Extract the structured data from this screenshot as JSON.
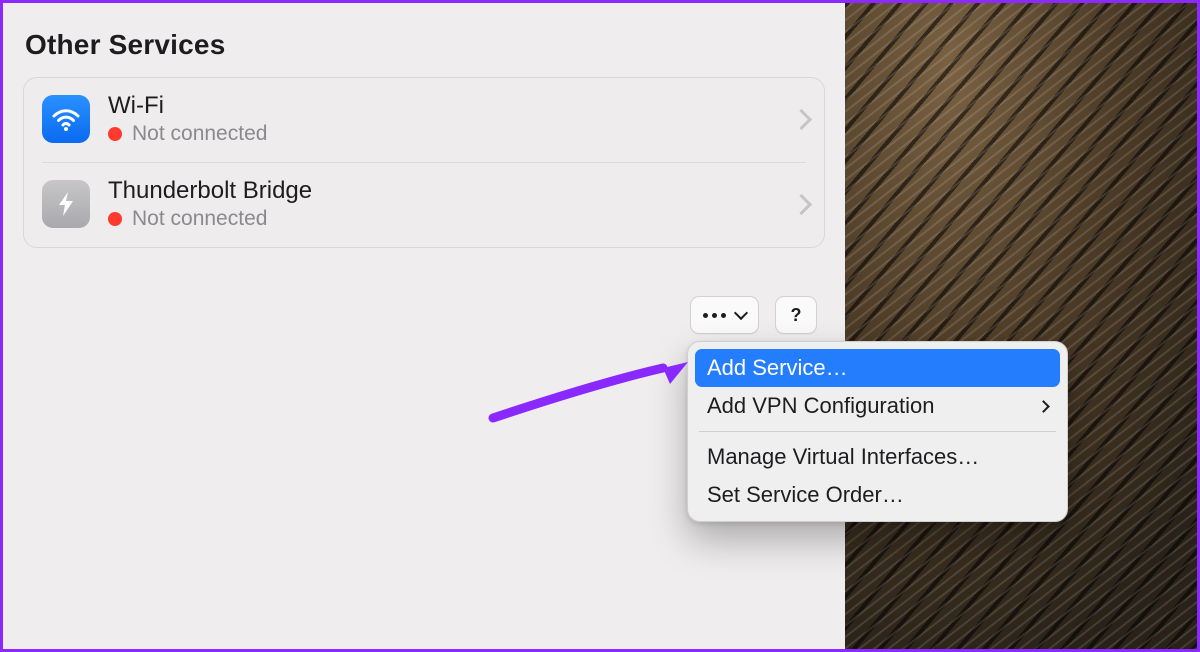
{
  "section": {
    "title": "Other Services"
  },
  "services": [
    {
      "name": "Wi-Fi",
      "status": "Not connected",
      "icon": "wifi"
    },
    {
      "name": "Thunderbolt Bridge",
      "status": "Not connected",
      "icon": "thunderbolt"
    }
  ],
  "actions": {
    "more_label": "more",
    "help_label": "?"
  },
  "dropdown": {
    "items": [
      {
        "label": "Add Service…",
        "highlighted": true,
        "has_submenu": false
      },
      {
        "label": "Add VPN Configuration",
        "highlighted": false,
        "has_submenu": true
      },
      {
        "label": "Manage Virtual Interfaces…",
        "highlighted": false,
        "has_submenu": false
      },
      {
        "label": "Set Service Order…",
        "highlighted": false,
        "has_submenu": false
      }
    ]
  }
}
